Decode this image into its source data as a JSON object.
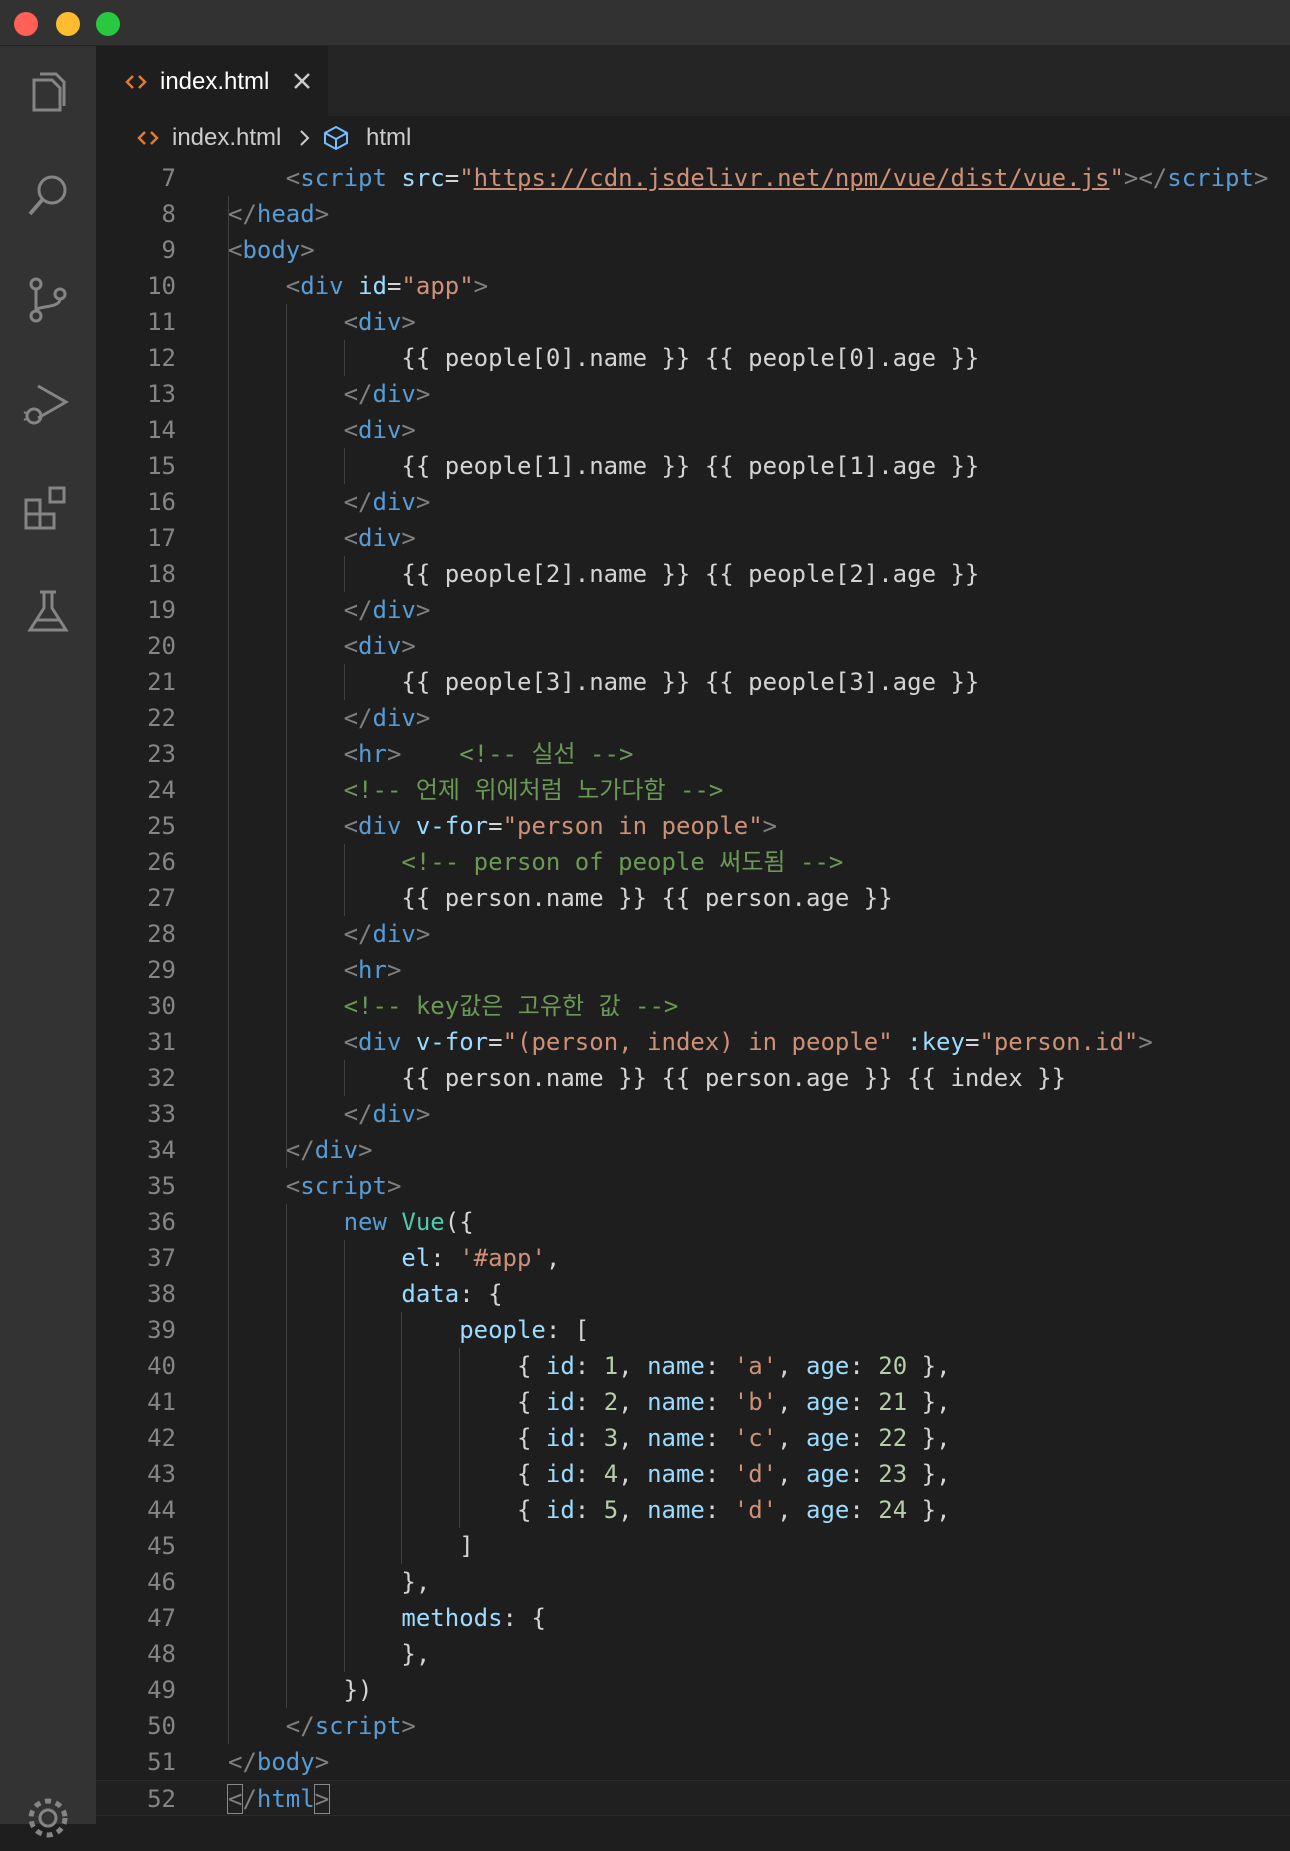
{
  "window": {
    "tab": {
      "label": "index.html"
    },
    "breadcrumb": {
      "file": "index.html",
      "symbol": "html"
    }
  },
  "activity_bar": {
    "icons": [
      "explorer-icon",
      "search-icon",
      "source-control-icon",
      "run-debug-icon",
      "extensions-icon",
      "testing-icon",
      "gear-icon"
    ]
  },
  "editor": {
    "current_line": 52,
    "lines": [
      {
        "n": "7",
        "tokens": [
          [
            "    ",
            "text"
          ],
          [
            "<",
            "punc"
          ],
          [
            "script",
            "tag"
          ],
          [
            " ",
            "text"
          ],
          [
            "src",
            "attr"
          ],
          [
            "=",
            "text"
          ],
          [
            "\"",
            "str"
          ],
          [
            "https://cdn.jsdelivr.net/npm/vue/dist/vue.js",
            "link"
          ],
          [
            "\"",
            "str"
          ],
          [
            "></",
            "punc"
          ],
          [
            "script",
            "tag"
          ],
          [
            ">",
            "punc"
          ]
        ]
      },
      {
        "n": "8",
        "tokens": [
          [
            "</",
            "punc"
          ],
          [
            "head",
            "tag"
          ],
          [
            ">",
            "punc"
          ]
        ]
      },
      {
        "n": "9",
        "tokens": [
          [
            "<",
            "punc"
          ],
          [
            "body",
            "tag"
          ],
          [
            ">",
            "punc"
          ]
        ]
      },
      {
        "n": "10",
        "tokens": [
          [
            "    ",
            "text"
          ],
          [
            "<",
            "punc"
          ],
          [
            "div",
            "tag"
          ],
          [
            " ",
            "text"
          ],
          [
            "id",
            "attr"
          ],
          [
            "=",
            "text"
          ],
          [
            "\"app\"",
            "str"
          ],
          [
            ">",
            "punc"
          ]
        ]
      },
      {
        "n": "11",
        "tokens": [
          [
            "        ",
            "text"
          ],
          [
            "<",
            "punc"
          ],
          [
            "div",
            "tag"
          ],
          [
            ">",
            "punc"
          ]
        ]
      },
      {
        "n": "12",
        "tokens": [
          [
            "            {{ people[0].name }} {{ people[0].age }}",
            "text"
          ]
        ]
      },
      {
        "n": "13",
        "tokens": [
          [
            "        ",
            "text"
          ],
          [
            "</",
            "punc"
          ],
          [
            "div",
            "tag"
          ],
          [
            ">",
            "punc"
          ]
        ]
      },
      {
        "n": "14",
        "tokens": [
          [
            "        ",
            "text"
          ],
          [
            "<",
            "punc"
          ],
          [
            "div",
            "tag"
          ],
          [
            ">",
            "punc"
          ]
        ]
      },
      {
        "n": "15",
        "tokens": [
          [
            "            {{ people[1].name }} {{ people[1].age }}",
            "text"
          ]
        ]
      },
      {
        "n": "16",
        "tokens": [
          [
            "        ",
            "text"
          ],
          [
            "</",
            "punc"
          ],
          [
            "div",
            "tag"
          ],
          [
            ">",
            "punc"
          ]
        ]
      },
      {
        "n": "17",
        "tokens": [
          [
            "        ",
            "text"
          ],
          [
            "<",
            "punc"
          ],
          [
            "div",
            "tag"
          ],
          [
            ">",
            "punc"
          ]
        ]
      },
      {
        "n": "18",
        "tokens": [
          [
            "            {{ people[2].name }} {{ people[2].age }}",
            "text"
          ]
        ]
      },
      {
        "n": "19",
        "tokens": [
          [
            "        ",
            "text"
          ],
          [
            "</",
            "punc"
          ],
          [
            "div",
            "tag"
          ],
          [
            ">",
            "punc"
          ]
        ]
      },
      {
        "n": "20",
        "tokens": [
          [
            "        ",
            "text"
          ],
          [
            "<",
            "punc"
          ],
          [
            "div",
            "tag"
          ],
          [
            ">",
            "punc"
          ]
        ]
      },
      {
        "n": "21",
        "tokens": [
          [
            "            {{ people[3].name }} {{ people[3].age }}",
            "text"
          ]
        ]
      },
      {
        "n": "22",
        "tokens": [
          [
            "        ",
            "text"
          ],
          [
            "</",
            "punc"
          ],
          [
            "div",
            "tag"
          ],
          [
            ">",
            "punc"
          ]
        ]
      },
      {
        "n": "23",
        "tokens": [
          [
            "        ",
            "text"
          ],
          [
            "<",
            "punc"
          ],
          [
            "hr",
            "tag"
          ],
          [
            ">",
            "punc"
          ],
          [
            "    ",
            "text"
          ],
          [
            "<!-- 실선 -->",
            "com"
          ]
        ]
      },
      {
        "n": "24",
        "tokens": [
          [
            "        ",
            "text"
          ],
          [
            "<!-- 언제 위에처럼 노가다함 -->",
            "com"
          ]
        ]
      },
      {
        "n": "25",
        "tokens": [
          [
            "        ",
            "text"
          ],
          [
            "<",
            "punc"
          ],
          [
            "div",
            "tag"
          ],
          [
            " ",
            "text"
          ],
          [
            "v-for",
            "attr"
          ],
          [
            "=",
            "text"
          ],
          [
            "\"person in people\"",
            "str"
          ],
          [
            ">",
            "punc"
          ]
        ]
      },
      {
        "n": "26",
        "tokens": [
          [
            "            ",
            "text"
          ],
          [
            "<!-- person of people 써도됨 -->",
            "com"
          ]
        ]
      },
      {
        "n": "27",
        "tokens": [
          [
            "            {{ person.name }} {{ person.age }}",
            "text"
          ]
        ]
      },
      {
        "n": "28",
        "tokens": [
          [
            "        ",
            "text"
          ],
          [
            "</",
            "punc"
          ],
          [
            "div",
            "tag"
          ],
          [
            ">",
            "punc"
          ]
        ]
      },
      {
        "n": "29",
        "tokens": [
          [
            "        ",
            "text"
          ],
          [
            "<",
            "punc"
          ],
          [
            "hr",
            "tag"
          ],
          [
            ">",
            "punc"
          ]
        ]
      },
      {
        "n": "30",
        "tokens": [
          [
            "        ",
            "text"
          ],
          [
            "<!-- key값은 고유한 값 -->",
            "com"
          ]
        ]
      },
      {
        "n": "31",
        "tokens": [
          [
            "        ",
            "text"
          ],
          [
            "<",
            "punc"
          ],
          [
            "div",
            "tag"
          ],
          [
            " ",
            "text"
          ],
          [
            "v-for",
            "attr"
          ],
          [
            "=",
            "text"
          ],
          [
            "\"(person, index) in people\"",
            "str"
          ],
          [
            " ",
            "text"
          ],
          [
            ":key",
            "attr"
          ],
          [
            "=",
            "text"
          ],
          [
            "\"person.id\"",
            "str"
          ],
          [
            ">",
            "punc"
          ]
        ]
      },
      {
        "n": "32",
        "tokens": [
          [
            "            {{ person.name }} {{ person.age }} {{ index }}",
            "text"
          ]
        ]
      },
      {
        "n": "33",
        "tokens": [
          [
            "        ",
            "text"
          ],
          [
            "</",
            "punc"
          ],
          [
            "div",
            "tag"
          ],
          [
            ">",
            "punc"
          ]
        ]
      },
      {
        "n": "34",
        "tokens": [
          [
            "    ",
            "text"
          ],
          [
            "</",
            "punc"
          ],
          [
            "div",
            "tag"
          ],
          [
            ">",
            "punc"
          ]
        ]
      },
      {
        "n": "35",
        "tokens": [
          [
            "    ",
            "text"
          ],
          [
            "<",
            "punc"
          ],
          [
            "script",
            "tag"
          ],
          [
            ">",
            "punc"
          ]
        ]
      },
      {
        "n": "36",
        "tokens": [
          [
            "        ",
            "text"
          ],
          [
            "new",
            "kw"
          ],
          [
            " ",
            "text"
          ],
          [
            "Vue",
            "cls"
          ],
          [
            "({",
            "bracket"
          ]
        ]
      },
      {
        "n": "37",
        "tokens": [
          [
            "            ",
            "text"
          ],
          [
            "el",
            "prop"
          ],
          [
            ": ",
            "op"
          ],
          [
            "'#app'",
            "str"
          ],
          [
            ",",
            "op"
          ]
        ]
      },
      {
        "n": "38",
        "tokens": [
          [
            "            ",
            "text"
          ],
          [
            "data",
            "prop"
          ],
          [
            ": {",
            "op"
          ]
        ]
      },
      {
        "n": "39",
        "tokens": [
          [
            "                ",
            "text"
          ],
          [
            "people",
            "prop"
          ],
          [
            ": [",
            "op"
          ]
        ]
      },
      {
        "n": "40",
        "tokens": [
          [
            "                    { ",
            "op"
          ],
          [
            "id",
            "prop"
          ],
          [
            ": ",
            "op"
          ],
          [
            "1",
            "num"
          ],
          [
            ", ",
            "op"
          ],
          [
            "name",
            "prop"
          ],
          [
            ": ",
            "op"
          ],
          [
            "'a'",
            "str"
          ],
          [
            ", ",
            "op"
          ],
          [
            "age",
            "prop"
          ],
          [
            ": ",
            "op"
          ],
          [
            "20",
            "num"
          ],
          [
            " },",
            "op"
          ]
        ]
      },
      {
        "n": "41",
        "tokens": [
          [
            "                    { ",
            "op"
          ],
          [
            "id",
            "prop"
          ],
          [
            ": ",
            "op"
          ],
          [
            "2",
            "num"
          ],
          [
            ", ",
            "op"
          ],
          [
            "name",
            "prop"
          ],
          [
            ": ",
            "op"
          ],
          [
            "'b'",
            "str"
          ],
          [
            ", ",
            "op"
          ],
          [
            "age",
            "prop"
          ],
          [
            ": ",
            "op"
          ],
          [
            "21",
            "num"
          ],
          [
            " },",
            "op"
          ]
        ]
      },
      {
        "n": "42",
        "tokens": [
          [
            "                    { ",
            "op"
          ],
          [
            "id",
            "prop"
          ],
          [
            ": ",
            "op"
          ],
          [
            "3",
            "num"
          ],
          [
            ", ",
            "op"
          ],
          [
            "name",
            "prop"
          ],
          [
            ": ",
            "op"
          ],
          [
            "'c'",
            "str"
          ],
          [
            ", ",
            "op"
          ],
          [
            "age",
            "prop"
          ],
          [
            ": ",
            "op"
          ],
          [
            "22",
            "num"
          ],
          [
            " },",
            "op"
          ]
        ]
      },
      {
        "n": "43",
        "tokens": [
          [
            "                    { ",
            "op"
          ],
          [
            "id",
            "prop"
          ],
          [
            ": ",
            "op"
          ],
          [
            "4",
            "num"
          ],
          [
            ", ",
            "op"
          ],
          [
            "name",
            "prop"
          ],
          [
            ": ",
            "op"
          ],
          [
            "'d'",
            "str"
          ],
          [
            ", ",
            "op"
          ],
          [
            "age",
            "prop"
          ],
          [
            ": ",
            "op"
          ],
          [
            "23",
            "num"
          ],
          [
            " },",
            "op"
          ]
        ]
      },
      {
        "n": "44",
        "tokens": [
          [
            "                    { ",
            "op"
          ],
          [
            "id",
            "prop"
          ],
          [
            ": ",
            "op"
          ],
          [
            "5",
            "num"
          ],
          [
            ", ",
            "op"
          ],
          [
            "name",
            "prop"
          ],
          [
            ": ",
            "op"
          ],
          [
            "'d'",
            "str"
          ],
          [
            ", ",
            "op"
          ],
          [
            "age",
            "prop"
          ],
          [
            ": ",
            "op"
          ],
          [
            "24",
            "num"
          ],
          [
            " },",
            "op"
          ]
        ]
      },
      {
        "n": "45",
        "tokens": [
          [
            "                ]",
            "op"
          ]
        ]
      },
      {
        "n": "46",
        "tokens": [
          [
            "            },",
            "op"
          ]
        ]
      },
      {
        "n": "47",
        "tokens": [
          [
            "            ",
            "text"
          ],
          [
            "methods",
            "prop"
          ],
          [
            ": {",
            "op"
          ]
        ]
      },
      {
        "n": "48",
        "tokens": [
          [
            "            },",
            "op"
          ]
        ]
      },
      {
        "n": "49",
        "tokens": [
          [
            "        })",
            "bracket"
          ]
        ]
      },
      {
        "n": "50",
        "tokens": [
          [
            "    ",
            "text"
          ],
          [
            "</",
            "punc"
          ],
          [
            "script",
            "tag"
          ],
          [
            ">",
            "punc"
          ]
        ]
      },
      {
        "n": "51",
        "tokens": [
          [
            "</",
            "punc"
          ],
          [
            "body",
            "tag"
          ],
          [
            ">",
            "punc"
          ]
        ]
      },
      {
        "n": "52",
        "tokens": [
          [
            "<",
            "bm-punc"
          ],
          [
            "/",
            "punc"
          ],
          [
            "html",
            "tag"
          ],
          [
            ">",
            "bm-punc"
          ]
        ]
      }
    ]
  }
}
